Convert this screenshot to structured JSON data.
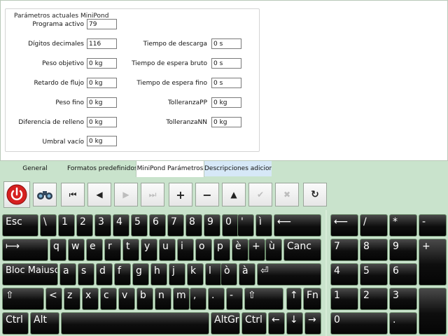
{
  "params_group": {
    "title": "Parámetros actuales MiniPond",
    "left": [
      {
        "label": "Programa activo",
        "value": "79"
      },
      {
        "label": "Dígitos decimales",
        "value": "116"
      },
      {
        "label": "Peso objetivo",
        "value": "0 kg"
      },
      {
        "label": "Retardo de flujo",
        "value": "0 kg"
      },
      {
        "label": "Peso fino",
        "value": "0 kg"
      },
      {
        "label": "Diferencia de relleno",
        "value": "0 kg"
      },
      {
        "label": "Umbral vacío",
        "value": "0 kg"
      }
    ],
    "right": [
      {
        "label": "Tiempo de descarga",
        "value": "0 s"
      },
      {
        "label": "Tiempo de espera bruto",
        "value": "0 s"
      },
      {
        "label": "Tiempo de espera fino",
        "value": "0 s"
      },
      {
        "label": "TolleranzaPP",
        "value": "0 kg"
      },
      {
        "label": "TolleranzaNN",
        "value": "0 kg"
      }
    ]
  },
  "tabs": [
    "General",
    "Formatos predefinidos",
    "MiniPond Parámetros",
    "Descripciones adicionales"
  ],
  "active_tab": "MiniPond Parámetros",
  "toolbar": {
    "first": "⏮",
    "prev": "◀",
    "next": "▶",
    "last": "⏭",
    "add": "+",
    "remove": "−",
    "up": "▲",
    "confirm": "✔",
    "cancel": "✖",
    "refresh": "↻"
  },
  "keyboard": {
    "row1": [
      "Esc",
      "\\",
      "1",
      "2",
      "3",
      "4",
      "5",
      "6",
      "7",
      "8",
      "9",
      "0",
      "'",
      "ì",
      "⟵"
    ],
    "row2": [
      "⟼",
      "q",
      "w",
      "e",
      "r",
      "t",
      "y",
      "u",
      "i",
      "o",
      "p",
      "è",
      "+",
      "ù",
      "Canc"
    ],
    "row3": [
      "Bloc Maiusc",
      "a",
      "s",
      "d",
      "f",
      "g",
      "h",
      "j",
      "k",
      "l",
      "ò",
      "à",
      "⏎"
    ],
    "row4": [
      "⇧",
      "<",
      "z",
      "x",
      "c",
      "v",
      "b",
      "n",
      "m",
      ",",
      ".",
      "-",
      "⇧",
      "↑",
      "Fn"
    ],
    "row5": [
      "Ctrl",
      "Alt",
      "",
      "AltGr",
      "Ctrl",
      "←",
      "↓",
      "→"
    ],
    "numpad": {
      "row1": [
        "⟵",
        "/",
        "*",
        "-"
      ],
      "row2": [
        "7",
        "8",
        "9",
        "+"
      ],
      "row3": [
        "4",
        "5",
        "6"
      ],
      "row4": [
        "1",
        "2",
        "3"
      ],
      "row5": [
        "0",
        "."
      ]
    }
  },
  "colors": {
    "background": "#c9e3cc",
    "key": "#111111",
    "power": "#d62020"
  }
}
